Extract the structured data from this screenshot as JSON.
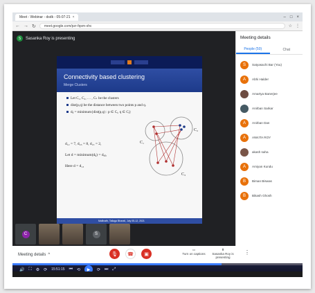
{
  "browser": {
    "tab_title": "Meet - Webinar - dsdk - 05-07-21",
    "url": "meet.google.com/pzr-fqsm-xhc"
  },
  "meet": {
    "presenter_initial": "S",
    "presenting_text": "Sasanka Roy is presenting"
  },
  "slide": {
    "title": "Connectivity based clustering",
    "subtitle": "Merge Clusters",
    "bullets": [
      "Let C₁, C₂, … , Cₖ be the clusters",
      "dist(p,q) be the distance between two points p and q.",
      "dᵢⱼ = minimum{dist(p,q) : p ∈ Cᵢ, q ∈ Cⱼ}"
    ],
    "math": [
      "d₁₂ = 7, d₂₃ = 8, d₁₃ = 2,",
      "Let d = minimum(dᵢⱼ) = dₐᵦ,",
      "Here d = d₁₃"
    ],
    "graph_labels": [
      "C₁",
      "C₂",
      "C₃"
    ],
    "footer": "Mallinath, Tallaga Bharati, July 05-12, 2021"
  },
  "strip": {
    "tiles": [
      {
        "initial": "C",
        "color": "#8e24aa"
      },
      {
        "initial": "",
        "color": ""
      },
      {
        "initial": "",
        "color": ""
      },
      {
        "initial": "S",
        "color": "#5f6368"
      },
      {
        "initial": "",
        "color": ""
      }
    ]
  },
  "controls": {
    "meeting_details": "Meeting details",
    "caret": "^",
    "captions": "Turn on captions",
    "present": "Sasanka Roy is presenting",
    "more": "⋮"
  },
  "player": {
    "timestamp": "15:51:15",
    "progress": 0.72
  },
  "panel": {
    "title": "Meeting details",
    "people_tab": "People (50)",
    "chat_tab": "Chat",
    "people": [
      {
        "name": "Satyasachi Bar (You)",
        "color": "#e8710a",
        "initial": "S"
      },
      {
        "name": "Abhi Halder",
        "color": "#e8710a",
        "initial": "A"
      },
      {
        "name": "Amartya Banerjee",
        "color": "#6d4c41",
        "initial": ""
      },
      {
        "name": "Anirban Sarkar",
        "color": "#455a64",
        "initial": ""
      },
      {
        "name": "Anirban Das",
        "color": "#e8710a",
        "initial": "A"
      },
      {
        "name": "ANKITA ROY",
        "color": "#e8710a",
        "initial": "A"
      },
      {
        "name": "akash saha",
        "color": "#795548",
        "initial": ""
      },
      {
        "name": "Amiyan Kundu",
        "color": "#e8710a",
        "initial": "A"
      },
      {
        "name": "Biman Biswas",
        "color": "#e8710a",
        "initial": "B"
      },
      {
        "name": "Bikash Ghosh",
        "color": "#e8710a",
        "initial": "B"
      }
    ]
  }
}
